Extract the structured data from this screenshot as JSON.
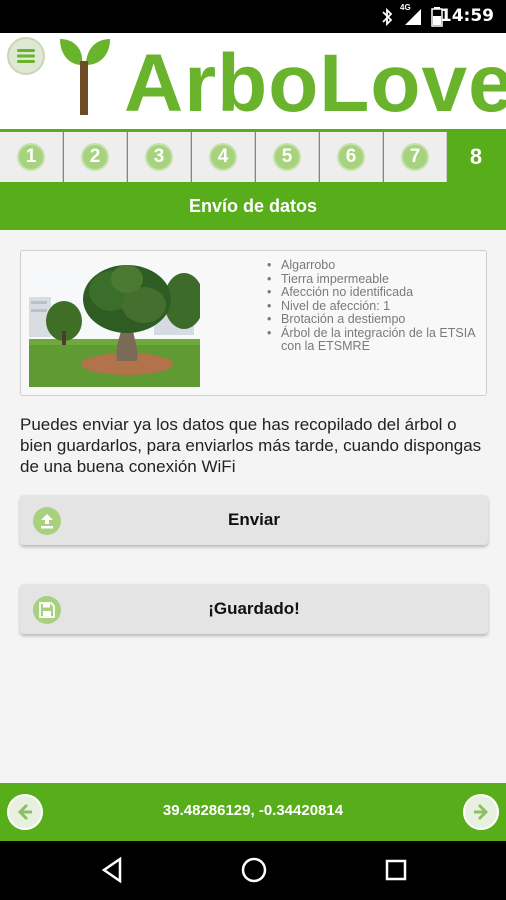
{
  "status_bar": {
    "time": "14:59",
    "network": "4G"
  },
  "header": {
    "app_name": "ArboLove"
  },
  "steps": [
    {
      "label": "1"
    },
    {
      "label": "2"
    },
    {
      "label": "3"
    },
    {
      "label": "4"
    },
    {
      "label": "5"
    },
    {
      "label": "6"
    },
    {
      "label": "7"
    },
    {
      "label": "8",
      "active": true
    }
  ],
  "section_title": "Envío de datos",
  "tree_details": [
    "Algarrobo",
    "Tierra impermeable",
    "Afección no identificada",
    "Nivel de afección: 1",
    "Brotación a destiempo",
    "Árbol de la integración de la ETSIA con la ETSMRE"
  ],
  "message": "Puedes enviar ya los datos que has recopilado del árbol o bien guardarlos, para enviarlos más tarde, cuando dispongas de una buena conexión WiFi",
  "buttons": {
    "send": "Enviar",
    "save": "¡Guardado!"
  },
  "footer": {
    "coordinates": "39.48286129, -0.34420814"
  },
  "icons": {
    "menu": "hamburger-icon",
    "send": "upload-icon",
    "save": "floppy-disk-icon",
    "prev": "arrow-left-icon",
    "next": "arrow-right-icon"
  },
  "colors": {
    "brand_green": "#58ad1a",
    "logo_green": "#6ab42d",
    "step_circle": "#a7d27e"
  }
}
